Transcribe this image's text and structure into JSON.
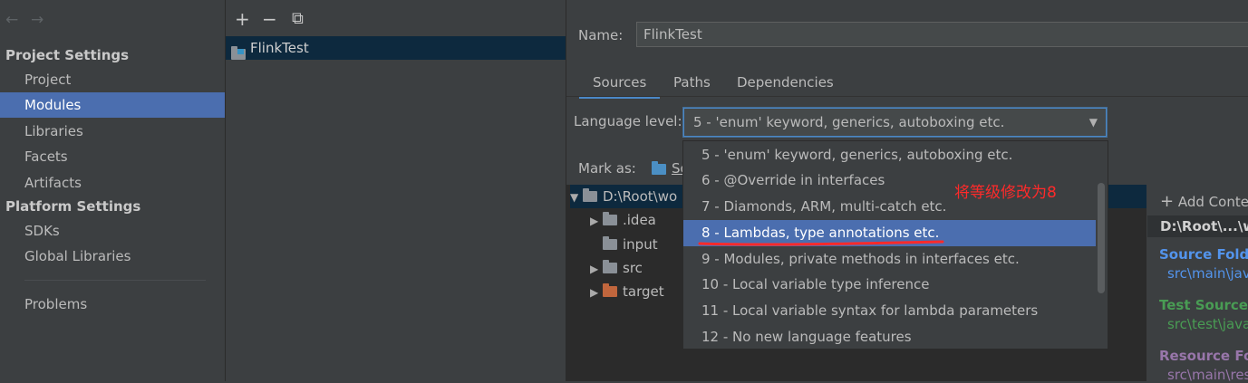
{
  "sidebar": {
    "nav_back": "←",
    "nav_forward": "→",
    "project_settings_header": "Project Settings",
    "project_items": [
      "Project",
      "Modules",
      "Libraries",
      "Facets",
      "Artifacts"
    ],
    "platform_settings_header": "Platform Settings",
    "platform_items": [
      "SDKs",
      "Global Libraries"
    ],
    "problems": "Problems",
    "selected": "Modules"
  },
  "modules_toolbar": {
    "add": "+",
    "remove": "−",
    "copy": "⧉"
  },
  "modules_list": {
    "items": [
      "FlinkTest"
    ]
  },
  "module_settings": {
    "name_label": "Name:",
    "name_value": "FlinkTest",
    "tabs": [
      "Sources",
      "Paths",
      "Dependencies"
    ],
    "active_tab": "Sources",
    "language_level_label": "Language level:",
    "language_level_value": "5 - 'enum' keyword, generics, autoboxing etc.",
    "mark_as_label": "Mark as:",
    "mark_as_partial": "So"
  },
  "tree": {
    "root": "D:\\Root\\wo",
    "children": [
      {
        "name": ".idea",
        "expandable": true
      },
      {
        "name": "input",
        "expandable": false
      },
      {
        "name": "src",
        "expandable": true
      },
      {
        "name": "target",
        "expandable": true
      }
    ]
  },
  "content_root_pane": {
    "add_content": "Add Conte",
    "root_path": "D:\\Root\\...\\w",
    "source_folders_label": "Source Folde",
    "source_folder_path": "src\\main\\java",
    "test_source_label": "Test Source F",
    "test_source_path": "src\\test\\java",
    "resource_label": "Resource Fold",
    "resource_path": "src\\main\\res"
  },
  "language_options": [
    "5 - 'enum' keyword, generics, autoboxing etc.",
    "6 - @Override in interfaces",
    "7 - Diamonds, ARM, multi-catch etc.",
    "8 - Lambdas, type annotations etc.",
    "9 - Modules, private methods in interfaces etc.",
    "10 - Local variable type inference",
    "11 - Local variable syntax for lambda parameters",
    "12 - No new language features"
  ],
  "selected_option": "8 - Lambdas, type annotations etc.",
  "annotation": "将等级修改为8",
  "colors": {
    "background": "#3c3f41",
    "selection": "#4b6eaf",
    "annotation": "#ff2a2a",
    "source_folder": "#5394ec",
    "test_folder": "#499c54",
    "resource_folder": "#9876aa"
  }
}
